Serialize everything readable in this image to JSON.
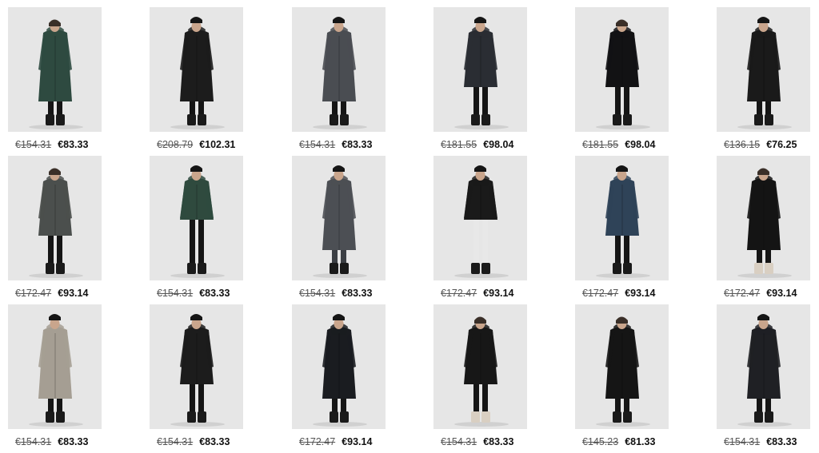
{
  "products": [
    {
      "old_price": "€154.31",
      "new_price": "€83.33",
      "coat_color": "#2e4a40",
      "coat_length": "long",
      "hat": false,
      "legs": "black",
      "icon": "coat-figure-icon"
    },
    {
      "old_price": "€208.79",
      "new_price": "€102.31",
      "coat_color": "#1c1c1c",
      "coat_length": "long",
      "hat": true,
      "legs": "black",
      "icon": "coat-figure-icon"
    },
    {
      "old_price": "€154.31",
      "new_price": "€83.33",
      "coat_color": "#4a4d52",
      "coat_length": "long",
      "hat": true,
      "legs": "black",
      "icon": "coat-figure-icon"
    },
    {
      "old_price": "€181.55",
      "new_price": "€98.04",
      "coat_color": "#2a2d33",
      "coat_length": "mid",
      "hat": true,
      "legs": "black",
      "icon": "coat-figure-icon"
    },
    {
      "old_price": "€181.55",
      "new_price": "€98.04",
      "coat_color": "#121214",
      "coat_length": "mid",
      "hat": false,
      "legs": "black",
      "icon": "coat-figure-icon"
    },
    {
      "old_price": "€136.15",
      "new_price": "€76.25",
      "coat_color": "#1a1a1a",
      "coat_length": "long",
      "hat": true,
      "legs": "black",
      "icon": "coat-figure-icon"
    },
    {
      "old_price": "€172.47",
      "new_price": "€93.14",
      "coat_color": "#4b4f4d",
      "coat_length": "mid",
      "hat": false,
      "legs": "black",
      "icon": "coat-figure-icon"
    },
    {
      "old_price": "€154.31",
      "new_price": "€83.33",
      "coat_color": "#2f4a3e",
      "coat_length": "short",
      "hat": true,
      "legs": "black",
      "icon": "coat-figure-icon"
    },
    {
      "old_price": "€154.31",
      "new_price": "€83.33",
      "coat_color": "#4c4f54",
      "coat_length": "long",
      "hat": true,
      "legs": "grey",
      "icon": "coat-figure-icon"
    },
    {
      "old_price": "€172.47",
      "new_price": "€93.14",
      "coat_color": "#1a1a1a",
      "coat_length": "short",
      "hat": true,
      "legs": "white",
      "icon": "coat-figure-icon"
    },
    {
      "old_price": "€172.47",
      "new_price": "€93.14",
      "coat_color": "#2f4358",
      "coat_length": "mid",
      "hat": true,
      "legs": "black",
      "icon": "coat-figure-icon"
    },
    {
      "old_price": "€172.47",
      "new_price": "€93.14",
      "coat_color": "#141414",
      "coat_length": "long",
      "hat": false,
      "legs": "beige",
      "icon": "coat-figure-icon"
    },
    {
      "old_price": "€154.31",
      "new_price": "€83.33",
      "coat_color": "#a59e93",
      "coat_length": "long",
      "hat": true,
      "legs": "black",
      "icon": "coat-figure-icon"
    },
    {
      "old_price": "€154.31",
      "new_price": "€83.33",
      "coat_color": "#1c1c1c",
      "coat_length": "mid",
      "hat": true,
      "legs": "black",
      "icon": "coat-figure-icon"
    },
    {
      "old_price": "€172.47",
      "new_price": "€93.14",
      "coat_color": "#1a1c20",
      "coat_length": "long",
      "hat": true,
      "legs": "black",
      "icon": "coat-figure-icon"
    },
    {
      "old_price": "€154.31",
      "new_price": "€83.33",
      "coat_color": "#171717",
      "coat_length": "mid",
      "hat": false,
      "legs": "beige",
      "icon": "coat-figure-icon"
    },
    {
      "old_price": "€145.23",
      "new_price": "€81.33",
      "coat_color": "#151515",
      "coat_length": "long",
      "hat": false,
      "legs": "black",
      "icon": "coat-figure-icon"
    },
    {
      "old_price": "€154.31",
      "new_price": "€83.33",
      "coat_color": "#1f2024",
      "coat_length": "long",
      "hat": true,
      "legs": "black",
      "icon": "coat-figure-icon"
    }
  ]
}
